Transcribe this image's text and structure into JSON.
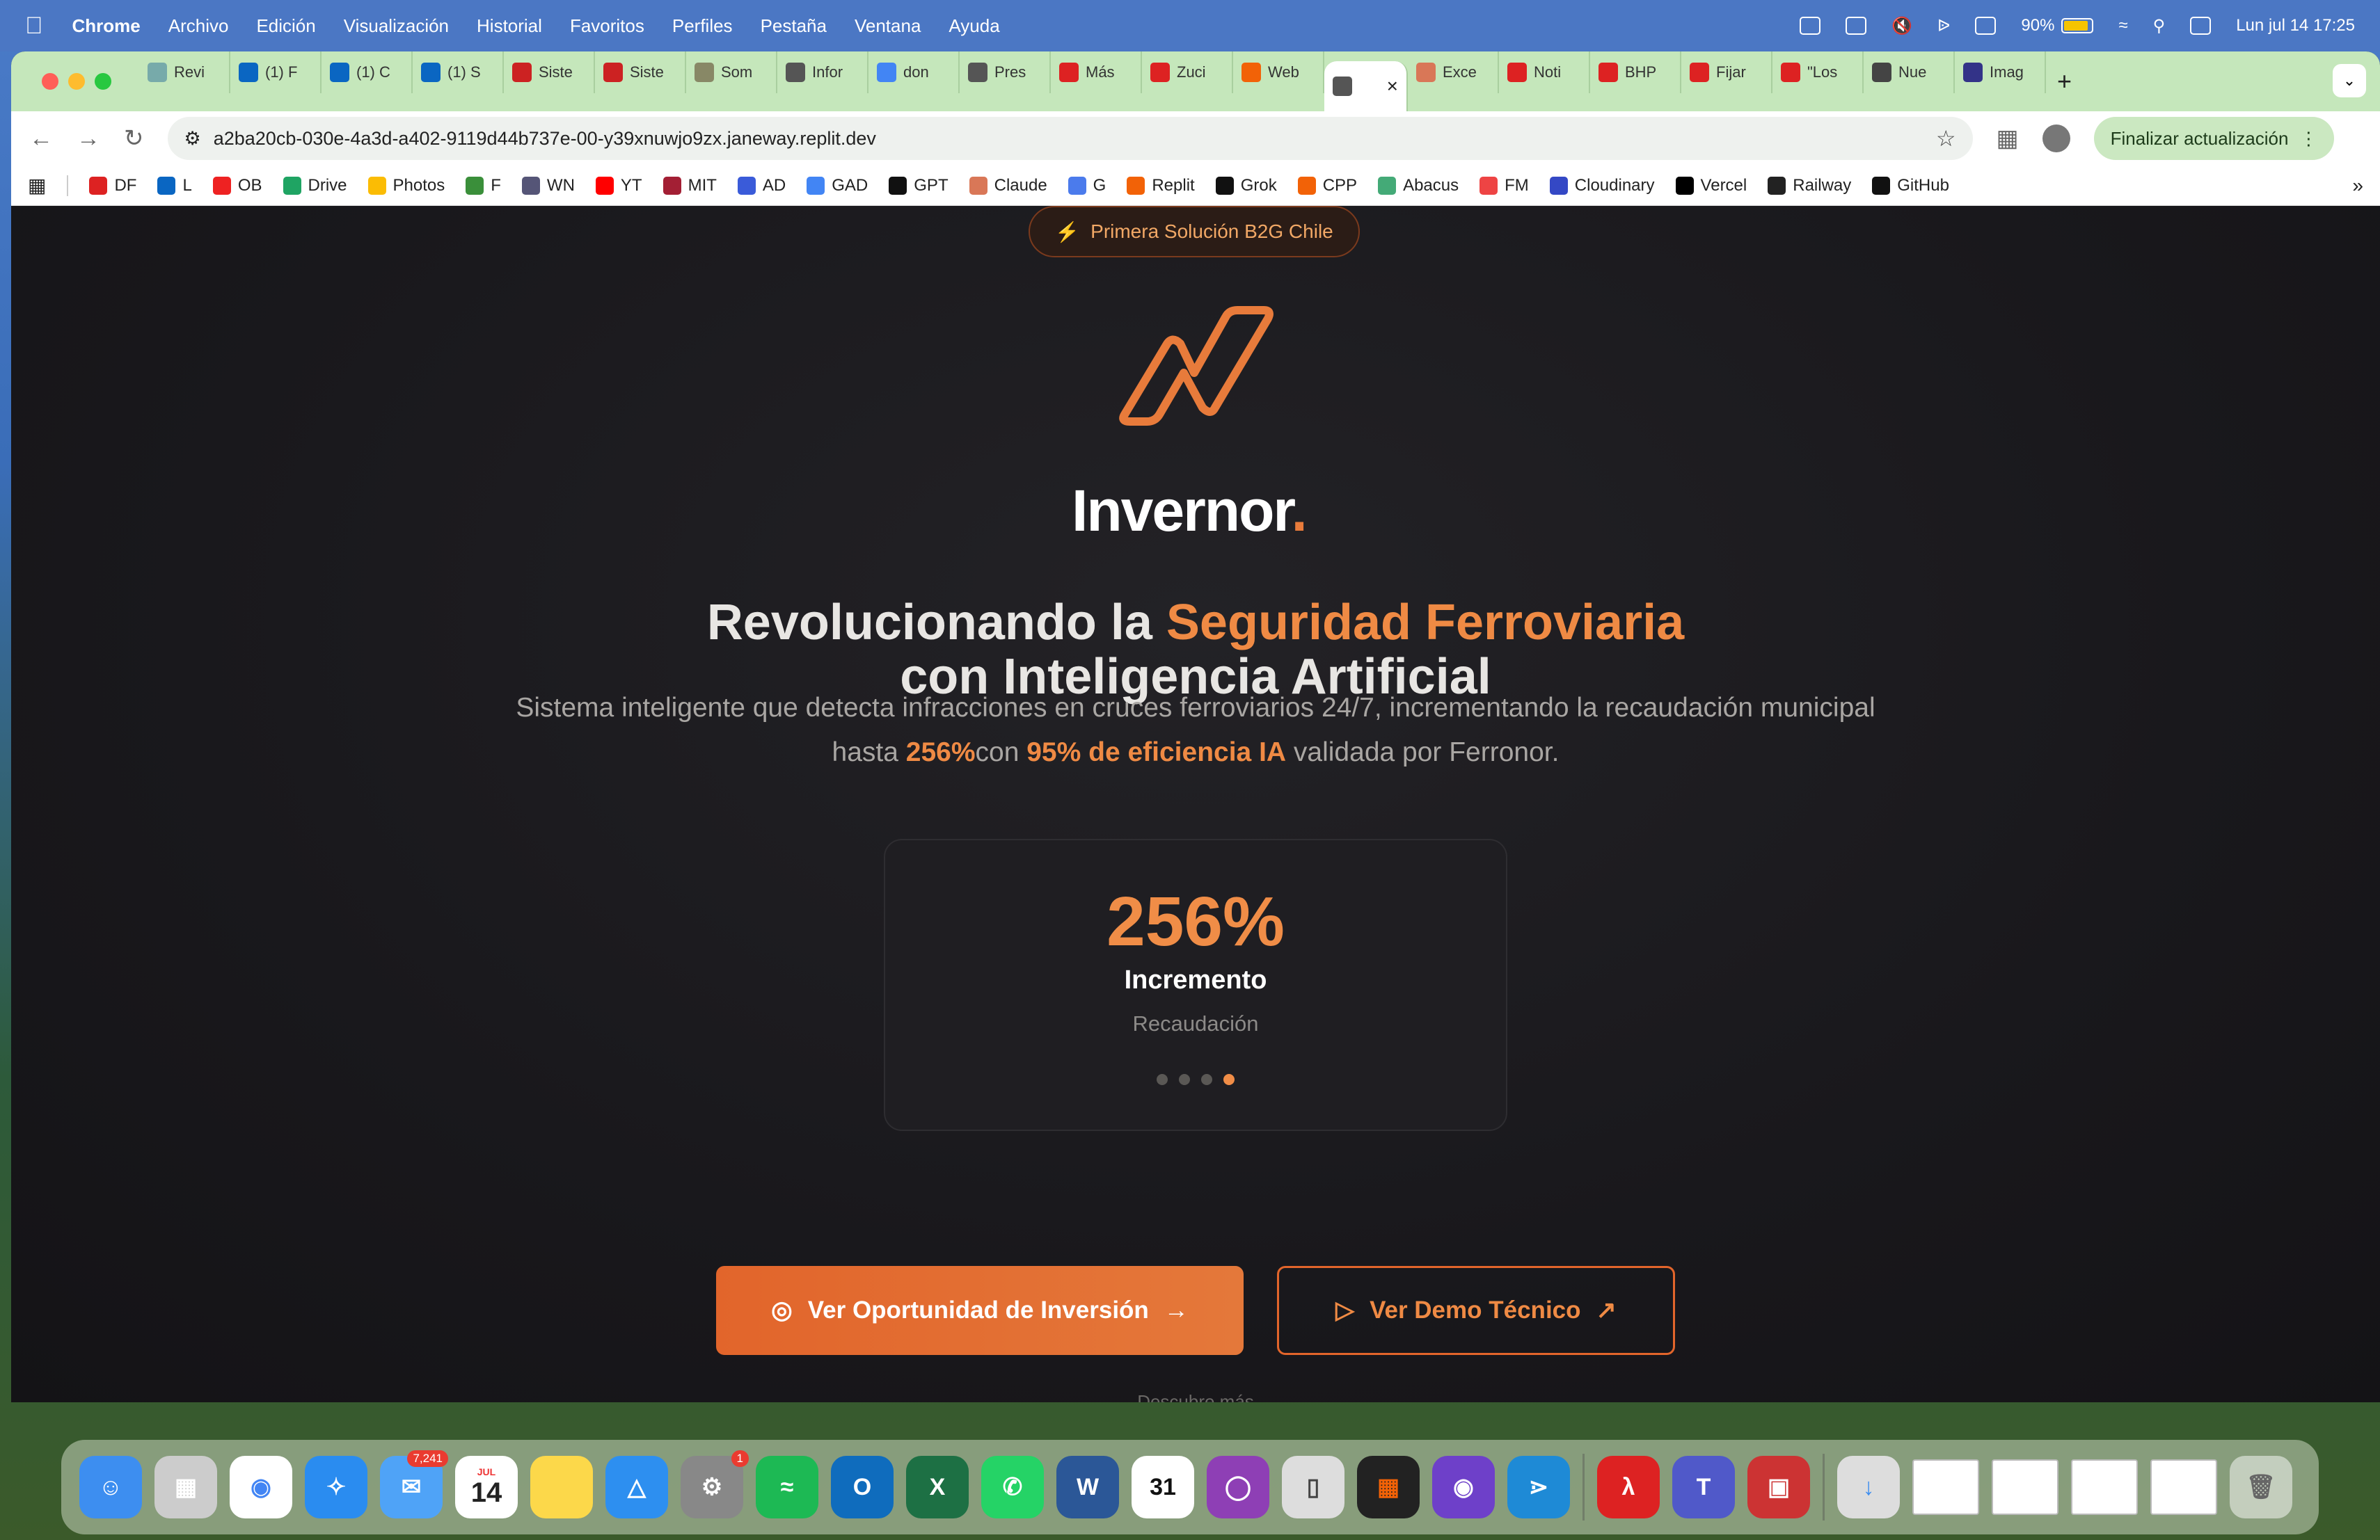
{
  "menubar": {
    "app": "Chrome",
    "items": [
      "Archivo",
      "Edición",
      "Visualización",
      "Historial",
      "Favoritos",
      "Perfiles",
      "Pestaña",
      "Ventana",
      "Ayuda"
    ],
    "battery": "90%",
    "datetime": "Lun jul 14  17:25"
  },
  "tabs": [
    {
      "label": "Revi",
      "color": "#7aa"
    },
    {
      "label": "(1) F",
      "color": "#0a66c2"
    },
    {
      "label": "(1) C",
      "color": "#0a66c2"
    },
    {
      "label": "(1) S",
      "color": "#0a66c2"
    },
    {
      "label": "Siste",
      "color": "#c22"
    },
    {
      "label": "Siste",
      "color": "#c22"
    },
    {
      "label": "Som",
      "color": "#886"
    },
    {
      "label": "Infor",
      "color": "#555"
    },
    {
      "label": "don",
      "color": "#4285f4"
    },
    {
      "label": "Pres",
      "color": "#555"
    },
    {
      "label": "Más",
      "color": "#d22"
    },
    {
      "label": "Zuci",
      "color": "#d22"
    },
    {
      "label": "Web",
      "color": "#f26207"
    },
    {
      "label": "",
      "color": "#555",
      "active": true
    },
    {
      "label": "Exce",
      "color": "#d97757"
    },
    {
      "label": "Noti",
      "color": "#d22"
    },
    {
      "label": "BHP",
      "color": "#d22"
    },
    {
      "label": "Fijar",
      "color": "#d22"
    },
    {
      "label": "\"Los",
      "color": "#d22"
    },
    {
      "label": "Nue",
      "color": "#444"
    },
    {
      "label": "Imag",
      "color": "#338"
    }
  ],
  "toolbar": {
    "url": "a2ba20cb-030e-4a3d-a402-9119d44b737e-00-y39xnuwjo9zx.janeway.replit.dev",
    "update_label": "Finalizar actualización"
  },
  "bookmarks": [
    {
      "label": "DF",
      "color": "#d22"
    },
    {
      "label": "L",
      "color": "#0a66c2"
    },
    {
      "label": "OB",
      "color": "#e22"
    },
    {
      "label": "Drive",
      "color": "#1fa463"
    },
    {
      "label": "Photos",
      "color": "#fbbc04"
    },
    {
      "label": "F",
      "color": "#3a8f3a"
    },
    {
      "label": "WN",
      "color": "#557"
    },
    {
      "label": "YT",
      "color": "#f00"
    },
    {
      "label": "MIT",
      "color": "#a31f34"
    },
    {
      "label": "AD",
      "color": "#3a5bd9"
    },
    {
      "label": "GAD",
      "color": "#4285f4"
    },
    {
      "label": "GPT",
      "color": "#111"
    },
    {
      "label": "Claude",
      "color": "#d97757"
    },
    {
      "label": "G",
      "color": "#4b7bec"
    },
    {
      "label": "Replit",
      "color": "#f26207"
    },
    {
      "label": "Grok",
      "color": "#111"
    },
    {
      "label": "CPP",
      "color": "#f26207"
    },
    {
      "label": "Abacus",
      "color": "#4a7"
    },
    {
      "label": "FM",
      "color": "#e44"
    },
    {
      "label": "Cloudinary",
      "color": "#3448c5"
    },
    {
      "label": "Vercel",
      "color": "#000"
    },
    {
      "label": "Railway",
      "color": "#222"
    },
    {
      "label": "GitHub",
      "color": "#111"
    }
  ],
  "hero": {
    "badge": "Primera Solución B2G Chile",
    "logo": "Invernor",
    "logo_dot": ".",
    "headline_pre": "Revolucionando la ",
    "headline_accent": "Seguridad Ferroviaria",
    "headline_post": "con Inteligencia Artificial",
    "sub_part1": "Sistema inteligente que detecta infracciones en cruces ferroviarios 24/7, incrementando la recaudación municipal hasta ",
    "sub_bold1": "256%",
    "sub_part2": "con ",
    "sub_bold2": "95% de eficiencia IA",
    "sub_part3": " validada por Ferronor.",
    "stat": {
      "value": "256%",
      "label": "Incremento",
      "sub": "Recaudación",
      "slides": 4,
      "active_slide": 4
    },
    "cta_primary": "Ver Oportunidad de Inversión",
    "cta_secondary": "Ver Demo Técnico",
    "scroll_hint": "Descubre más"
  },
  "dock": {
    "mail_badge": "7,241",
    "calendar_month": "JUL",
    "calendar_day": "14",
    "settings_badge": "1"
  },
  "colors": {
    "accent": "#ef8a44",
    "page_bg": "#19181c",
    "tab_bar": "#c5e7bb"
  }
}
